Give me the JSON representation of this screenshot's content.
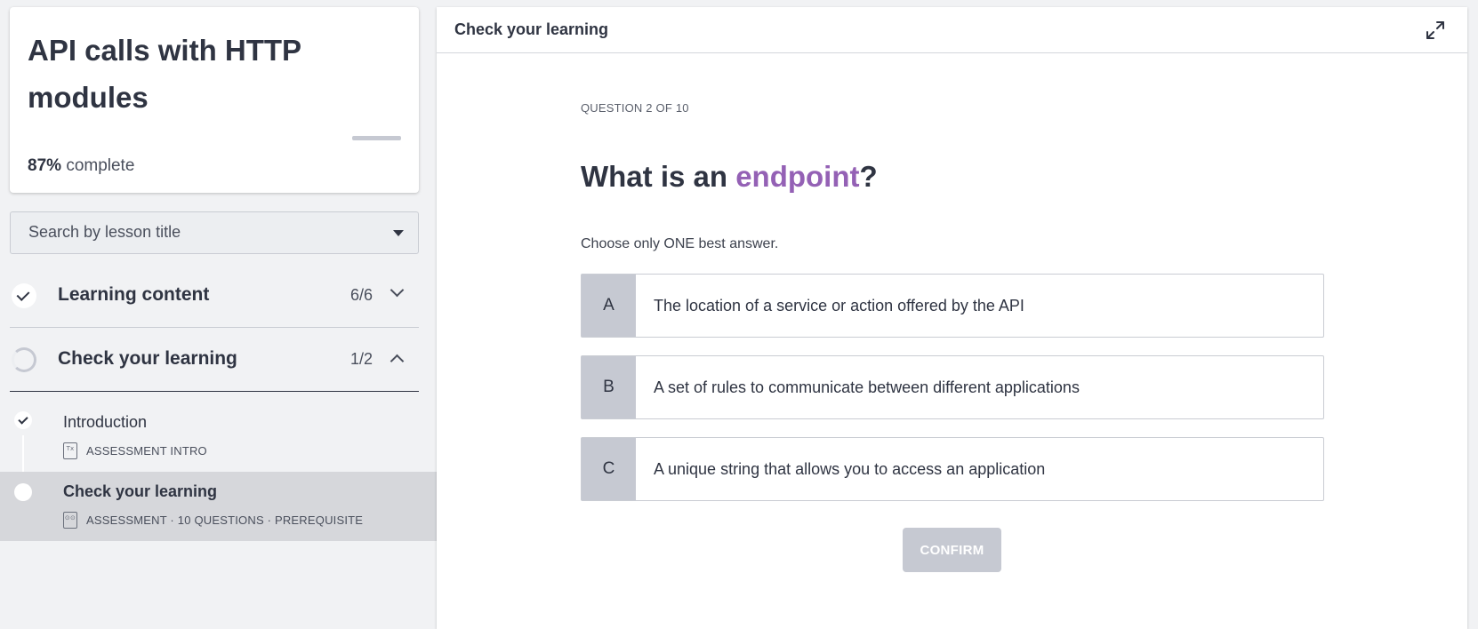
{
  "course": {
    "title": "API calls with HTTP modules",
    "progress_percent": 87,
    "progress_label": "87%",
    "complete_suffix": "complete"
  },
  "search": {
    "placeholder": "Search by lesson title"
  },
  "sections": [
    {
      "title": "Learning content",
      "count": "6/6",
      "state": "done",
      "expanded": false
    },
    {
      "title": "Check your learning",
      "count": "1/2",
      "state": "in-progress",
      "expanded": true
    }
  ],
  "lessons": [
    {
      "title": "Introduction",
      "meta": "ASSESSMENT INTRO",
      "icon": "text-doc-icon",
      "status": "done"
    },
    {
      "title": "Check your learning",
      "meta": "ASSESSMENT · 10 QUESTIONS · PREREQUISITE",
      "icon": "quiz-doc-icon",
      "status": "current"
    }
  ],
  "main": {
    "header_title": "Check your learning",
    "question_counter": "QUESTION 2 OF 10",
    "question_prefix": "What is an ",
    "question_keyword": "endpoint",
    "question_suffix": "?",
    "instruction": "Choose only ONE best answer.",
    "options": [
      {
        "letter": "A",
        "text": "The location of a service or action offered by the API"
      },
      {
        "letter": "B",
        "text": "A set of rules to communicate between different applications"
      },
      {
        "letter": "C",
        "text": "A unique string that allows you to access an application"
      }
    ],
    "confirm_label": "CONFIRM"
  },
  "colors": {
    "accent_keyword": "#9461b5",
    "text": "#2f3442",
    "letter_bg": "#c6c9d2",
    "current_lesson_bg": "#d6d7db"
  }
}
